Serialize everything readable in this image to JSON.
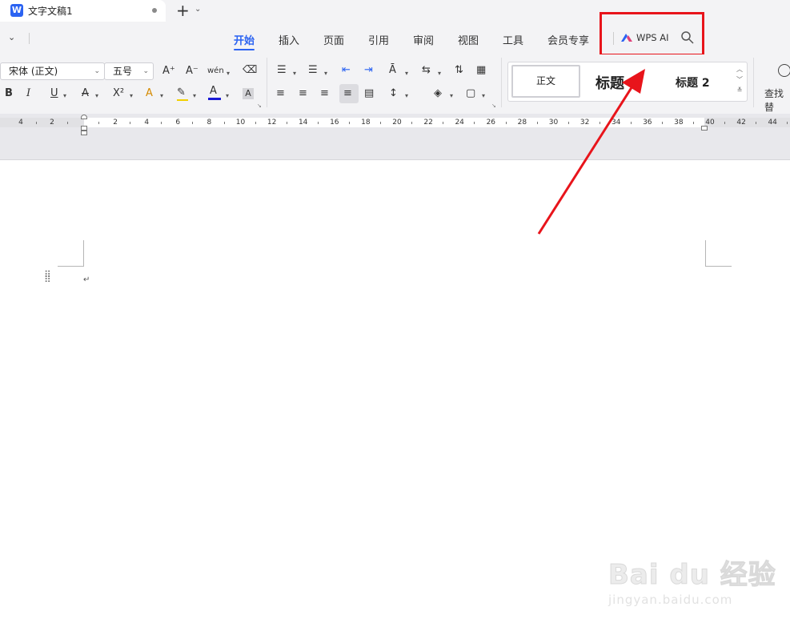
{
  "tab": {
    "app_letter": "W",
    "doc_title": "文字文稿1"
  },
  "menu": {
    "items": [
      "开始",
      "插入",
      "页面",
      "引用",
      "审阅",
      "视图",
      "工具",
      "会员专享"
    ],
    "active_index": 0,
    "wps_ai": "WPS AI"
  },
  "ribbon": {
    "font_name": "宋体 (正文)",
    "font_size": "五号",
    "font_grow": "A⁺",
    "font_shrink": "A⁻",
    "pinyin": "wén",
    "bold": "B",
    "italic": "I",
    "underline": "U",
    "strike": "A",
    "superscript": "X²",
    "text_effect": "A",
    "font_color": "A",
    "char_shading": "A",
    "styles": {
      "normal": "正文",
      "heading1": "标题 1",
      "heading2": "标题 2"
    },
    "find_label": "查找替"
  },
  "ruler": {
    "labels": [
      "4",
      "2",
      "2",
      "4",
      "6",
      "8",
      "10",
      "12",
      "14",
      "16",
      "18",
      "20",
      "22",
      "24",
      "26",
      "28",
      "30",
      "32",
      "34",
      "36",
      "38",
      "40",
      "42",
      "44"
    ]
  },
  "page": {
    "paragraph_mark": "↵"
  },
  "watermark": {
    "logo": "Bai du 经验",
    "url": "jingyan.baidu.com"
  },
  "colors": {
    "accent": "#2b63f2",
    "annotation": "#e8141b",
    "font_color_bar": "#1a1ad6"
  }
}
